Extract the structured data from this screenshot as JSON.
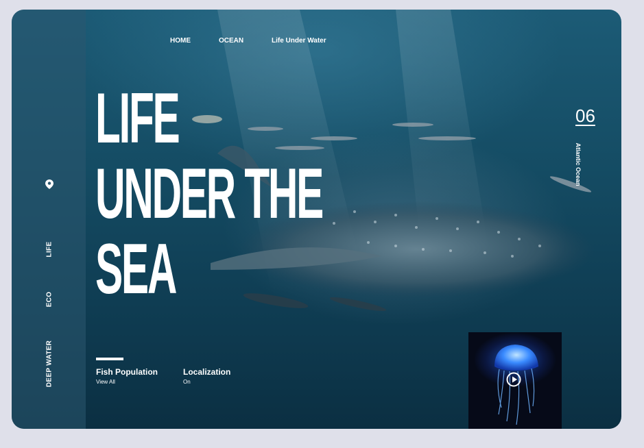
{
  "nav": {
    "items": [
      "HOME",
      "OCEAN",
      "Life Under Water"
    ]
  },
  "sidebar": {
    "items": [
      "LIFE",
      "ECO",
      "DEEP WATER"
    ]
  },
  "hero": {
    "lines": [
      "LIFE",
      "UNDER THE",
      "SEA"
    ]
  },
  "counter": {
    "number": "06",
    "label": "Atlantic Ocean"
  },
  "stats": [
    {
      "title": "Fish Population",
      "link": "View All"
    },
    {
      "title": "Localization",
      "link": "On"
    }
  ],
  "colors": {
    "background": "#dfe0ea",
    "ocean_dark": "#0f3d53",
    "ocean_light": "#1c5b76",
    "text": "#ffffff",
    "jellyfish_glow": "#3a8bff"
  },
  "icons": {
    "location": "pin-icon",
    "play": "play-icon"
  }
}
